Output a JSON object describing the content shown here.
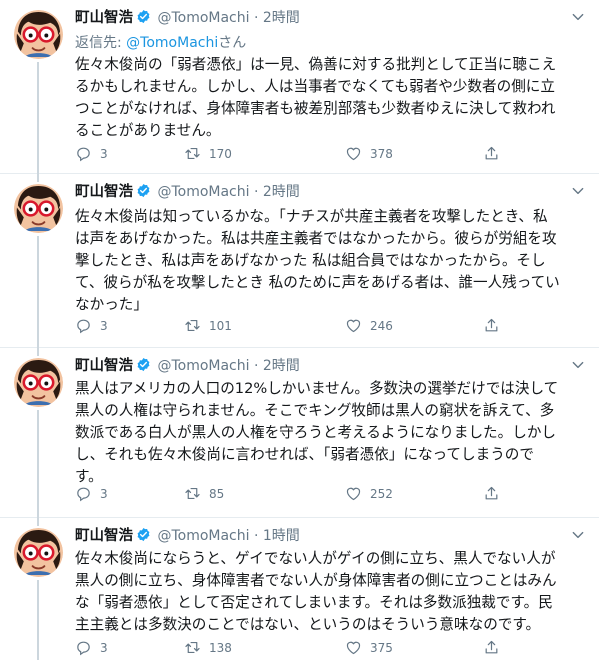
{
  "colors": {
    "accent": "#1b95e0",
    "verified": "#1da1f2",
    "muted": "#657786",
    "text": "#14171a",
    "divider": "#e6ecf0"
  },
  "tweets": [
    {
      "author": "町山智浩",
      "handle": "@TomoMachi",
      "dot": "·",
      "time": "2時間",
      "reply_label": "返信先: ",
      "reply_handle": "@TomoMachi",
      "reply_suffix": "さん",
      "text": "佐々木俊尚の「弱者憑依」は一見、偽善に対する批判として正当に聴こえ\nるかもしれません。しかし、人は当事者でなくても弱者や少数者の側に立\nつことがなければ、身体障害者も被差別部落も少数者ゆえに決して救われ\nることがありません。",
      "replies": "3",
      "retweets": "170",
      "likes": "378"
    },
    {
      "author": "町山智浩",
      "handle": "@TomoMachi",
      "dot": "·",
      "time": "2時間",
      "text": "佐々木俊尚は知っているかな。「ナチスが共産主義者を攻撃したとき、私\nは声をあげなかった。私は共産主義者ではなかったから。彼らが労組を攻\n撃したとき、私は声をあげなかった 私は組合員ではなかったから。そし\nて、彼らが私を攻撃したとき 私のために声をあげる者は、誰一人残ってい\nなかった」",
      "replies": "3",
      "retweets": "101",
      "likes": "246"
    },
    {
      "author": "町山智浩",
      "handle": "@TomoMachi",
      "dot": "·",
      "time": "2時間",
      "text": "黒人はアメリカの人口の12%しかいません。多数決の選挙だけでは決して\n黒人の人権は守られません。そこでキング牧師は黒人の窮状を訴えて、多\n数派である白人が黒人の人権を守ろうと考えるようになりました。しかし\nし、それも佐々木俊尚に言わせれば、「弱者憑依」になってしまうので\nす。",
      "replies": "3",
      "retweets": "85",
      "likes": "252"
    },
    {
      "author": "町山智浩",
      "handle": "@TomoMachi",
      "dot": "·",
      "time": "1時間",
      "text": "佐々木俊尚にならうと、ゲイでない人がゲイの側に立ち、黒人でない人が\n黒人の側に立ち、身体障害者でない人が身体障害者の側に立つことはみん\nな「弱者憑依」として否定されてしまいます。それは多数派独裁です。民\n主主義とは多数決のことではない、というのはそういう意味なのです。",
      "replies": "3",
      "retweets": "138",
      "likes": "375"
    }
  ],
  "icons": {
    "avatar": "avatar-glasses-man",
    "verified": "verified-badge-icon",
    "menu": "chevron-down-icon",
    "reply": "reply-icon",
    "retweet": "retweet-icon",
    "like": "heart-icon",
    "share": "share-icon"
  }
}
